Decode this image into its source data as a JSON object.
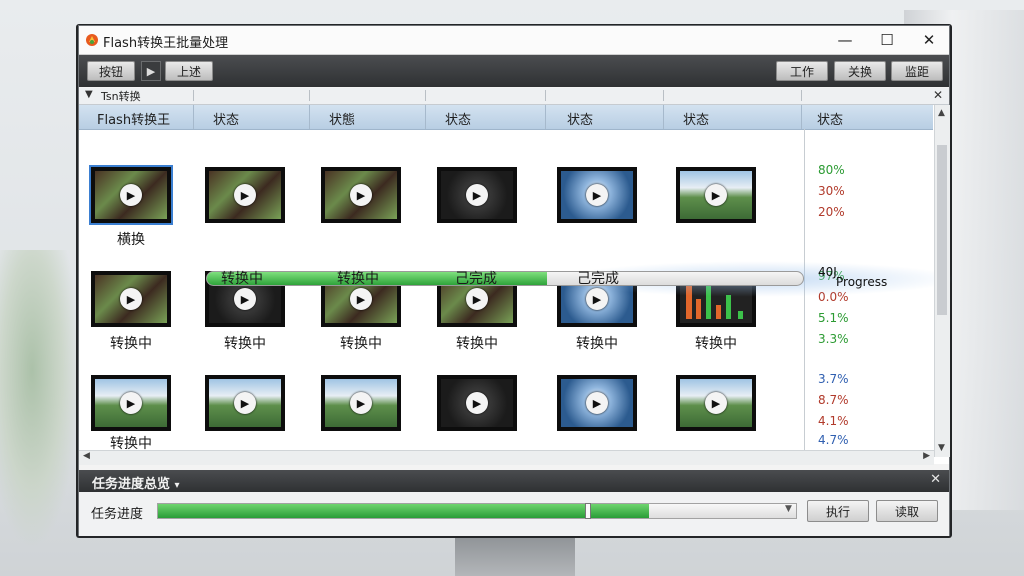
{
  "window": {
    "title": "Flash转换王批量处理",
    "minimize": "—",
    "maximize": "☐",
    "close": "✕"
  },
  "toolbar": {
    "btn1": "按钮",
    "btn2": "上述",
    "right1": "工作",
    "right2": "关换",
    "right3": "监距"
  },
  "filter": {
    "label": "Tsn转换"
  },
  "columns": [
    "Flash转换王",
    "状态",
    "状態",
    "状态",
    "状态",
    "状态",
    "状态"
  ],
  "rows": [
    {
      "thumbs": [
        "forest",
        "forest",
        "forest",
        "dark",
        "sky",
        "landscape"
      ],
      "captions": [
        "横换",
        "",
        "",
        "",
        "",
        ""
      ],
      "percents": [
        {
          "v": "80%",
          "c": "g"
        },
        {
          "v": "30%",
          "c": "r"
        },
        {
          "v": "20%",
          "c": "r"
        }
      ]
    },
    {
      "thumbs": [
        "forest",
        "dark",
        "forest",
        "forest",
        "sky",
        "chart"
      ],
      "captions": [
        "转换中",
        "转换中",
        "转换中",
        "转换中",
        "转换中",
        "转换中"
      ],
      "percents": [
        {
          "v": "97%",
          "c": "g"
        },
        {
          "v": "0.0%",
          "c": "r"
        },
        {
          "v": "5.1%",
          "c": "g"
        },
        {
          "v": "3.3%",
          "c": "g"
        }
      ]
    },
    {
      "thumbs": [
        "landscape",
        "landscape",
        "landscape",
        "dark",
        "sky",
        "landscape"
      ],
      "captions": [
        "转换中",
        "",
        "",
        "",
        "",
        ""
      ],
      "percents": [
        {
          "v": "3.7%",
          "c": "b"
        },
        {
          "v": "8.7%",
          "c": "r"
        },
        {
          "v": "4.1%",
          "c": "r"
        }
      ]
    }
  ],
  "partial_row_percent": "4.7%",
  "progress_row": {
    "labels": [
      "转换中",
      "转换中",
      "己完成",
      "己完成"
    ],
    "fill_fraction": 0.57,
    "value": "40J",
    "word": "Progress"
  },
  "panel": {
    "title": "任务进度总览",
    "pin": "▾",
    "close": "✕",
    "task_label": "任务进度",
    "task_fraction": 0.77,
    "btn_left": "执行",
    "btn_right": "读取"
  }
}
